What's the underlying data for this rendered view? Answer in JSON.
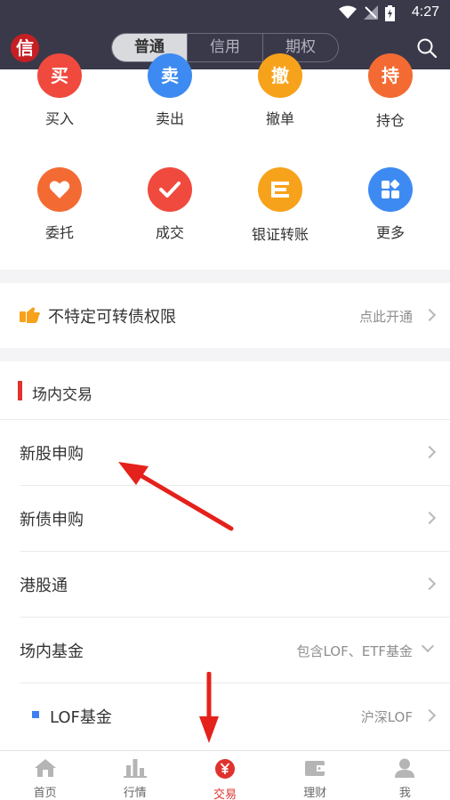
{
  "status": {
    "time": "4:27"
  },
  "header": {
    "logo_char": "信",
    "tabs": [
      "普通",
      "信用",
      "期权"
    ]
  },
  "quick_actions": [
    {
      "icon_text": "买",
      "label": "买入",
      "color": "#f04a3e"
    },
    {
      "icon_text": "卖",
      "label": "卖出",
      "color": "#3d8bf2"
    },
    {
      "icon_text": "撤",
      "label": "撤单",
      "color": "#f7a21b"
    },
    {
      "icon_text": "持",
      "label": "持仓",
      "color": "#f36b33"
    },
    {
      "icon": "heart-icon",
      "label": "委托",
      "color": "#f36b33"
    },
    {
      "icon": "check-icon",
      "label": "成交",
      "color": "#f04a3e"
    },
    {
      "icon": "transfer-icon",
      "label": "银证转账",
      "color": "#f7a21b"
    },
    {
      "icon": "grid-icon",
      "label": "更多",
      "color": "#3d8bf2"
    }
  ],
  "banner": {
    "label": "不特定可转债权限",
    "hint": "点此开通"
  },
  "section": {
    "title": "场内交易",
    "items": [
      {
        "label": "新股申购"
      },
      {
        "label": "新债申购"
      },
      {
        "label": "港股通"
      },
      {
        "label": "场内基金",
        "hint": "包含LOF、ETF基金"
      },
      {
        "label": "LOF基金",
        "hint": "沪深LOF"
      }
    ]
  },
  "tabbar": {
    "items": [
      {
        "label": "首页",
        "icon": "home-icon"
      },
      {
        "label": "行情",
        "icon": "chart-icon"
      },
      {
        "label": "交易",
        "icon": "yuan-icon",
        "active": true
      },
      {
        "label": "理财",
        "icon": "wallet-icon"
      },
      {
        "label": "我",
        "icon": "user-icon"
      }
    ]
  },
  "colors": {
    "accent": "#e0332e",
    "header_bg": "#39394a"
  }
}
